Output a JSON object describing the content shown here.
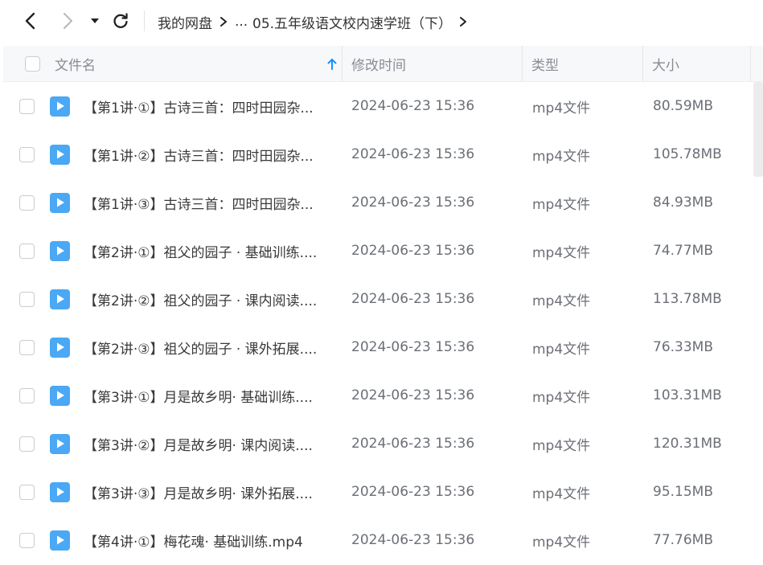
{
  "breadcrumb": {
    "root": "我的网盘",
    "ellipsis": "...",
    "current": "05.五年级语文校内速学班（下）"
  },
  "header": {
    "name": "文件名",
    "modified": "修改时间",
    "type": "类型",
    "size": "大小"
  },
  "files": [
    {
      "name": "【第1讲·①】古诗三首：四时田园杂...",
      "modified": "2024-06-23 15:36",
      "type": "mp4文件",
      "size": "80.59MB"
    },
    {
      "name": "【第1讲·②】古诗三首：四时田园杂...",
      "modified": "2024-06-23 15:36",
      "type": "mp4文件",
      "size": "105.78MB"
    },
    {
      "name": "【第1讲·③】古诗三首：四时田园杂...",
      "modified": "2024-06-23 15:36",
      "type": "mp4文件",
      "size": "84.93MB"
    },
    {
      "name": "【第2讲·①】祖父的园子 · 基础训练....",
      "modified": "2024-06-23 15:36",
      "type": "mp4文件",
      "size": "74.77MB"
    },
    {
      "name": "【第2讲·②】祖父的园子 · 课内阅读....",
      "modified": "2024-06-23 15:36",
      "type": "mp4文件",
      "size": "113.78MB"
    },
    {
      "name": "【第2讲·③】祖父的园子 · 课外拓展....",
      "modified": "2024-06-23 15:36",
      "type": "mp4文件",
      "size": "76.33MB"
    },
    {
      "name": "【第3讲·①】月是故乡明· 基础训练....",
      "modified": "2024-06-23 15:36",
      "type": "mp4文件",
      "size": "103.31MB"
    },
    {
      "name": "【第3讲·②】月是故乡明· 课内阅读....",
      "modified": "2024-06-23 15:36",
      "type": "mp4文件",
      "size": "120.31MB"
    },
    {
      "name": "【第3讲·③】月是故乡明· 课外拓展....",
      "modified": "2024-06-23 15:36",
      "type": "mp4文件",
      "size": "95.15MB"
    },
    {
      "name": "【第4讲·①】梅花魂· 基础训练.mp4",
      "modified": "2024-06-23 15:36",
      "type": "mp4文件",
      "size": "77.76MB"
    }
  ],
  "colors": {
    "accent": "#1a90ff",
    "file_icon": "#4aa8f5"
  }
}
